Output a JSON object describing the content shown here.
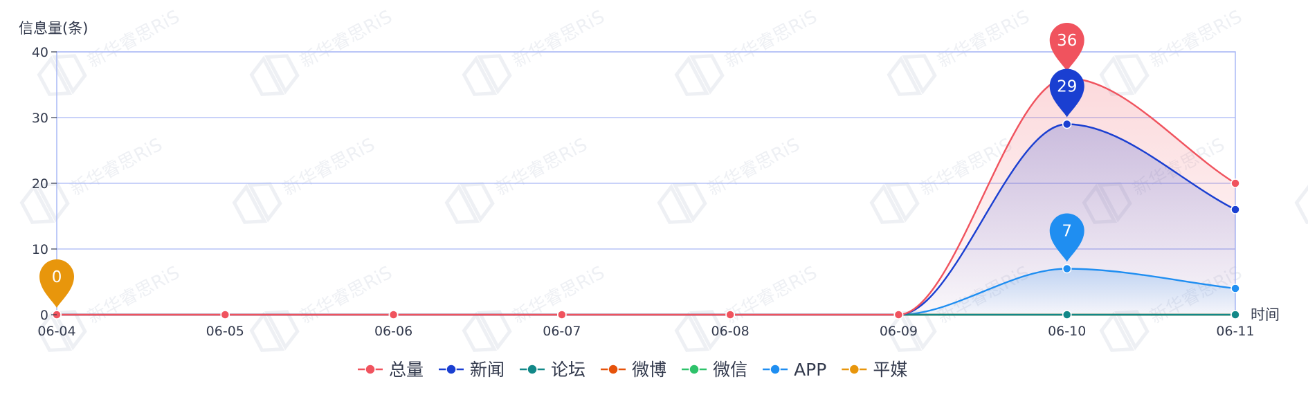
{
  "chart_data": {
    "type": "line",
    "ylabel": "信息量(条)",
    "xlabel": "时间",
    "categories": [
      "06-04",
      "06-05",
      "06-06",
      "06-07",
      "06-08",
      "06-09",
      "06-10",
      "06-11"
    ],
    "ylim": [
      0,
      40
    ],
    "yticks": [
      0,
      10,
      20,
      30,
      40
    ],
    "grid": true,
    "legend_position": "bottom-center",
    "watermark": "新华睿思RiS",
    "series": [
      {
        "name": "总量",
        "color": "#f0535e",
        "values": [
          0,
          0,
          0,
          0,
          0,
          0,
          36,
          20
        ],
        "area": true
      },
      {
        "name": "新闻",
        "color": "#1a3fd1",
        "values": [
          0,
          0,
          0,
          0,
          0,
          0,
          29,
          16
        ],
        "area": true
      },
      {
        "name": "论坛",
        "color": "#128888",
        "values": [
          0,
          0,
          0,
          0,
          0,
          0,
          0,
          0
        ],
        "area": false
      },
      {
        "name": "微博",
        "color": "#e6520a",
        "values": [
          0,
          0,
          0,
          0,
          0,
          0,
          0,
          0
        ],
        "area": false
      },
      {
        "name": "微信",
        "color": "#2ec26a",
        "values": [
          0,
          0,
          0,
          0,
          0,
          0,
          0,
          0
        ],
        "area": false
      },
      {
        "name": "APP",
        "color": "#1f8ef1",
        "values": [
          0,
          0,
          0,
          0,
          0,
          0,
          7,
          4
        ],
        "area": true
      },
      {
        "name": "平媒",
        "color": "#e8960c",
        "values": [
          0,
          0,
          0,
          0,
          0,
          0,
          0,
          0
        ],
        "area": false
      }
    ],
    "annotations": [
      {
        "series": "总量",
        "category": "06-10",
        "label": "36"
      },
      {
        "series": "新闻",
        "category": "06-10",
        "label": "29"
      },
      {
        "series": "APP",
        "category": "06-10",
        "label": "7"
      },
      {
        "series": "平媒",
        "category": "06-04",
        "label": "0"
      }
    ]
  }
}
